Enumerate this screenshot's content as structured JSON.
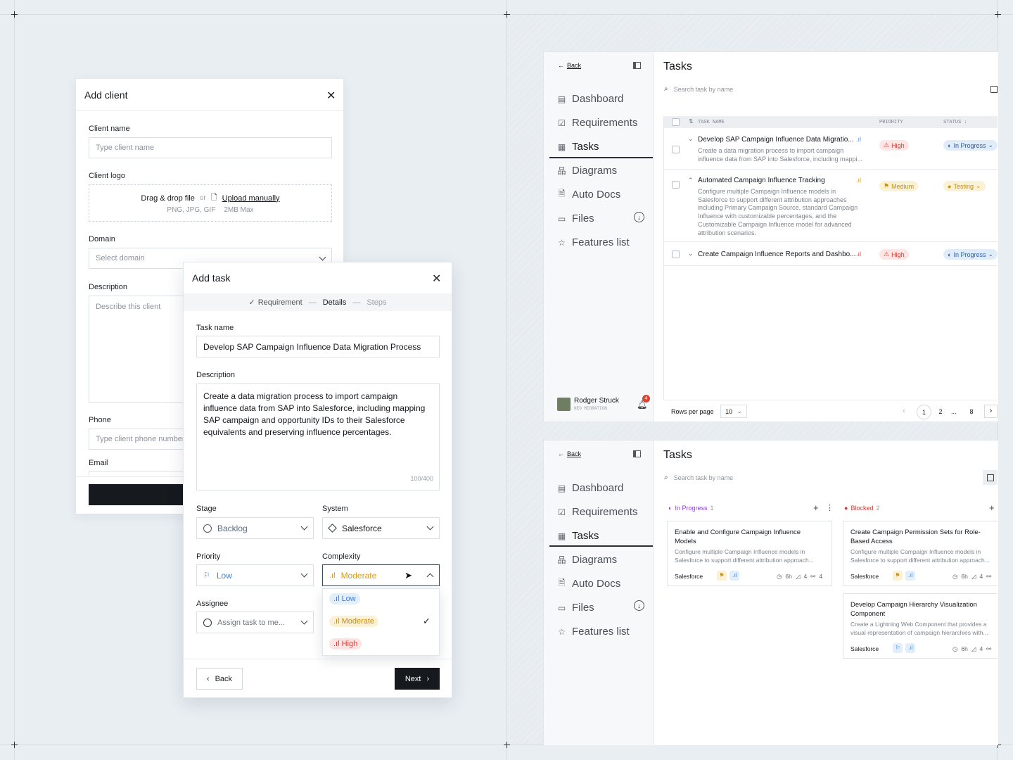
{
  "add_client": {
    "title": "Add client",
    "client_name_label": "Client name",
    "client_name_placeholder": "Type client name",
    "client_logo_label": "Client logo",
    "drag_drop": "Drag & drop file",
    "or": "or",
    "upload_manually": "Upload manually",
    "file_types": "PNG, JPG, GIF",
    "max_size": "2MB Max",
    "domain_label": "Domain",
    "domain_placeholder": "Select domain",
    "description_label": "Description",
    "description_placeholder": "Describe this client",
    "phone_label": "Phone",
    "phone_placeholder": "Type client phone number",
    "email_label": "Email"
  },
  "add_task": {
    "title": "Add task",
    "steps": [
      "Requirement",
      "Details",
      "Steps"
    ],
    "task_name_label": "Task name",
    "task_name_value": "Develop SAP Campaign Influence Data Migration Process",
    "description_label": "Description",
    "description_value": "Create a data migration process to import campaign influence data from SAP into Salesforce, including mapping SAP campaign and opportunity IDs to their Salesforce equivalents and preserving influence percentages.",
    "char_count": "100/400",
    "stage_label": "Stage",
    "stage_value": "Backlog",
    "system_label": "System",
    "system_value": "Salesforce",
    "priority_label": "Priority",
    "priority_value": "Low",
    "complexity_label": "Complexity",
    "complexity_value": "Moderate",
    "assignee_label": "Assignee",
    "assignee_placeholder": "Assign task to me...",
    "complexity_options": [
      "Low",
      "Moderate",
      "High"
    ],
    "back_label": "Back",
    "next_label": "Next"
  },
  "sidebar": {
    "back_label": "Back",
    "items": [
      "Dashboard",
      "Requirements",
      "Tasks",
      "Diagrams",
      "Auto Docs",
      "Files",
      "Features list"
    ],
    "user_name": "Rodger Struck",
    "user_sub": "NEO MIGRATION",
    "notif_count": "4"
  },
  "tasks_list": {
    "title": "Tasks",
    "search_placeholder": "Search task by name",
    "columns": [
      "TASK NAME",
      "PRIORITY",
      "STATUS"
    ],
    "rows": [
      {
        "name": "Develop SAP Campaign Influence Data Migratio...",
        "desc": "Create a data migration process to import campaign influence data from SAP into Salesforce, including mappi...",
        "priority": "High",
        "status": "In Progress"
      },
      {
        "name": "Automated Campaign Influence Tracking",
        "desc": "Configure multiple Campaign Influence models in Salesforce to support different attribution approaches including Primary Campaign Source, standard Campaign Influence with customizable percentages, and the Customizable Campaign Influence model for advanced attribution scenarios.",
        "priority": "Medium",
        "status": "Testing"
      },
      {
        "name": "Create Campaign Influence Reports and Dashbo...",
        "desc": "",
        "priority": "High",
        "status": "In Progress"
      }
    ],
    "rows_per_page_label": "Rows per page",
    "rows_per_page": "10",
    "pages": [
      "1",
      "2",
      "...",
      "8"
    ]
  },
  "tasks_board": {
    "title": "Tasks",
    "search_placeholder": "Search task by name",
    "col1_title": "In Progress",
    "col1_count": "1",
    "col2_title": "Blocked",
    "col2_count": "2",
    "card1": {
      "title": "Enable and Configure Campaign Influence Models",
      "desc": "Configure multiple Campaign Influence models in Salesforce to support different attribution approach...",
      "system": "Salesforce",
      "hours": "6h",
      "a": "4",
      "b": "4"
    },
    "card2": {
      "title": "Create Campaign Permission Sets for Role-Based Access",
      "desc": "Configure multiple Campaign Influence models in Salesforce to support different attribution approach...",
      "system": "Salesforce",
      "hours": "6h",
      "a": "4"
    },
    "card3": {
      "title": "Develop Campaign Hierarchy Visualization Component",
      "desc": "Create a Lightning Web Component that provides a visual representation of campaign hierarchies with...",
      "system": "Salesforce",
      "hours": "6h",
      "a": "4"
    }
  }
}
